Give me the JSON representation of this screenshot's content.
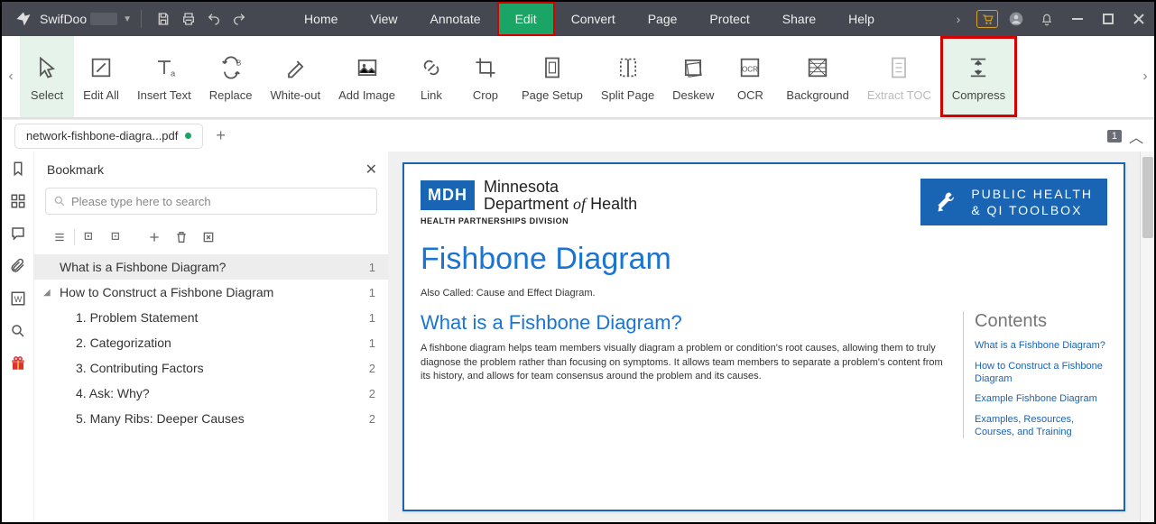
{
  "app": {
    "name": "SwifDoo"
  },
  "menu": [
    "Home",
    "View",
    "Annotate",
    "Edit",
    "Convert",
    "Page",
    "Protect",
    "Share",
    "Help"
  ],
  "menu_active_index": 3,
  "ribbon": [
    {
      "label": "Select",
      "icon": "cursor"
    },
    {
      "label": "Edit All",
      "icon": "edit"
    },
    {
      "label": "Insert Text",
      "icon": "text"
    },
    {
      "label": "Replace",
      "icon": "replace"
    },
    {
      "label": "White-out",
      "icon": "whiteout"
    },
    {
      "label": "Add Image",
      "icon": "image"
    },
    {
      "label": "Link",
      "icon": "link"
    },
    {
      "label": "Crop",
      "icon": "crop"
    },
    {
      "label": "Page Setup",
      "icon": "pagesetup"
    },
    {
      "label": "Split Page",
      "icon": "split"
    },
    {
      "label": "Deskew",
      "icon": "deskew"
    },
    {
      "label": "OCR",
      "icon": "ocr"
    },
    {
      "label": "Background",
      "icon": "background"
    },
    {
      "label": "Extract TOC",
      "icon": "extract",
      "dim": true
    },
    {
      "label": "Compress",
      "icon": "compress",
      "boxed": true
    }
  ],
  "tab": {
    "filename": "network-fishbone-diagra...pdf"
  },
  "page_badge": "1",
  "bookmark": {
    "title": "Bookmark",
    "search_placeholder": "Please type here to search",
    "items": [
      {
        "text": "What is a Fishbone Diagram?",
        "page": "1",
        "sel": true,
        "level": 0,
        "arrow": ""
      },
      {
        "text": "How to Construct a Fishbone Diagram",
        "page": "1",
        "level": 0,
        "arrow": "◢"
      },
      {
        "text": "1. Problem Statement",
        "page": "1",
        "level": 1
      },
      {
        "text": "2. Categorization",
        "page": "1",
        "level": 1
      },
      {
        "text": "3. Contributing Factors",
        "page": "2",
        "level": 1
      },
      {
        "text": "4. Ask: Why?",
        "page": "2",
        "level": 1
      },
      {
        "text": "5. Many Ribs: Deeper Causes",
        "page": "2",
        "level": 1
      }
    ]
  },
  "doc": {
    "mdh_abbr": "MDH",
    "mdh_l1": "Minnesota",
    "mdh_l2a": "Department ",
    "mdh_l2b": "of",
    "mdh_l2c": " Health",
    "hpd": "HEALTH PARTNERSHIPS DIVISION",
    "toolbox_l1": "PUBLIC HEALTH",
    "toolbox_l2": "& QI TOOLBOX",
    "title": "Fishbone Diagram",
    "also": "Also Called: Cause and Effect Diagram.",
    "sec1_h": "What is a Fishbone Diagram?",
    "sec1_p": "A fishbone diagram helps team members visually diagram a problem or condition's root causes, allowing them to truly diagnose the problem rather than focusing on symptoms. It allows team members to separate a problem's content from its history, and allows for team consensus around the problem and its causes.",
    "contents_h": "Contents",
    "contents": [
      "What is a Fishbone Diagram?",
      "How to Construct a Fishbone Diagram",
      "Example Fishbone Diagram",
      "Examples, Resources, Courses, and Training"
    ]
  }
}
